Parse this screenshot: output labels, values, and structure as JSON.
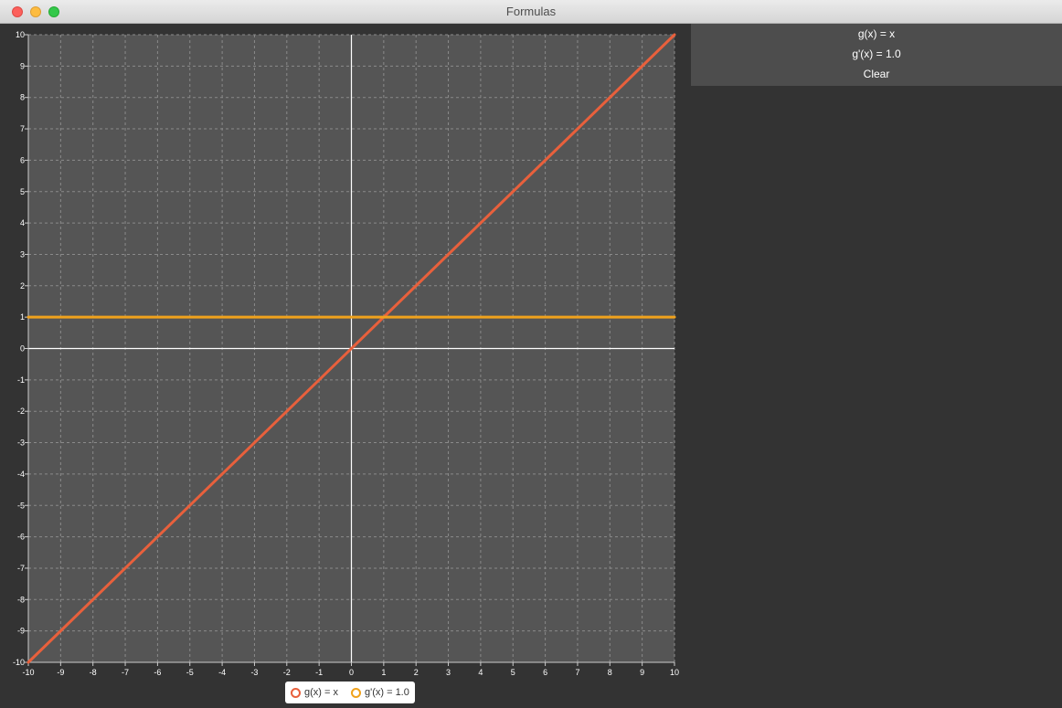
{
  "window": {
    "title": "Formulas"
  },
  "side_panel": {
    "items": [
      "g(x) = x",
      "g'(x) = 1.0",
      "Clear"
    ]
  },
  "legend": {
    "entries": [
      {
        "label": "g(x) = x",
        "color": "#e8603c"
      },
      {
        "label": "g'(x) = 1.0",
        "color": "#f0a21c"
      }
    ]
  },
  "chart_data": {
    "type": "line",
    "title": "",
    "xlabel": "",
    "ylabel": "",
    "xlim": [
      -10,
      10
    ],
    "ylim": [
      -10,
      10
    ],
    "xticks": [
      -10,
      -9,
      -8,
      -7,
      -6,
      -5,
      -4,
      -3,
      -2,
      -1,
      0,
      1,
      2,
      3,
      4,
      5,
      6,
      7,
      8,
      9,
      10
    ],
    "yticks": [
      -10,
      -9,
      -8,
      -7,
      -6,
      -5,
      -4,
      -3,
      -2,
      -1,
      0,
      1,
      2,
      3,
      4,
      5,
      6,
      7,
      8,
      9,
      10
    ],
    "grid": true,
    "legend_position": "bottom",
    "background": "#555555",
    "series": [
      {
        "name": "g(x) = x",
        "color": "#e8603c",
        "x": [
          -10,
          10
        ],
        "y": [
          -10,
          10
        ]
      },
      {
        "name": "g'(x) = 1.0",
        "color": "#f0a21c",
        "x": [
          -10,
          10
        ],
        "y": [
          1,
          1
        ]
      }
    ]
  }
}
